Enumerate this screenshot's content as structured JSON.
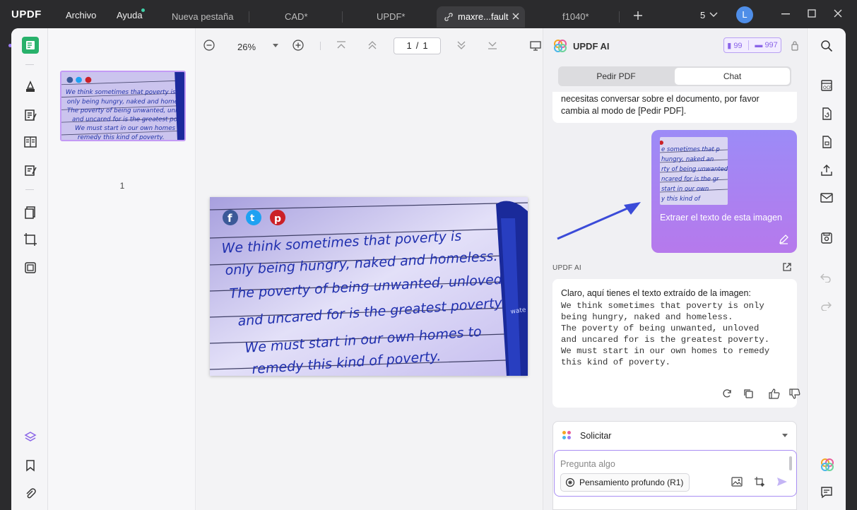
{
  "app": {
    "logo": "UPDF"
  },
  "menu": {
    "file": "Archivo",
    "help": "Ayuda"
  },
  "tabs": [
    {
      "label": "Nueva pestaña"
    },
    {
      "label": "CAD*"
    },
    {
      "label": "UPDF*"
    },
    {
      "label": "maxre...fault"
    },
    {
      "label": "f1040*"
    }
  ],
  "window": {
    "count": "5",
    "avatar": "L"
  },
  "viewer": {
    "zoom": "26%",
    "page_current": "1",
    "page_total": "1",
    "thumb_page_number": "1"
  },
  "image_text": {
    "line1": "We think sometimes that poverty is",
    "line2": "only being hungry, naked and homeless.",
    "line3": "The poverty of being unwanted, unloved",
    "line4": "and uncared for is the greatest poverty.",
    "line5": "We must start in our own homes to",
    "line6": "remedy this kind of poverty."
  },
  "ai": {
    "title": "UPDF AI",
    "quota_a": "99",
    "quota_b": "997",
    "tab_ask": "Pedir PDF",
    "tab_chat": "Chat",
    "prev_msg_line1": "necesitas conversar sobre el documento, por favor",
    "prev_msg_line2": "cambia al modo de [Pedir PDF].",
    "user_msg": "Extraer el texto de esta imagen",
    "sender": "UPDF AI",
    "reply_intro": "Claro, aquí tienes el texto extraído de la imagen:",
    "reply_lines": [
      "We think sometimes that poverty is only",
      "being hungry, naked and homeless.",
      "The poverty of being unwanted, unloved",
      "and uncared for is the greatest poverty.",
      "We must start in our own homes to remedy",
      "this kind of poverty."
    ],
    "prompt_label": "Solicitar",
    "input_placeholder": "Pregunta algo",
    "deep_thinking": "Pensamiento profundo (R1)"
  },
  "colors": {
    "accent": "#8a64e8",
    "bubble_start": "#9c8bf7",
    "bubble_end": "#b679ec",
    "arrow": "#3b4bd8"
  }
}
